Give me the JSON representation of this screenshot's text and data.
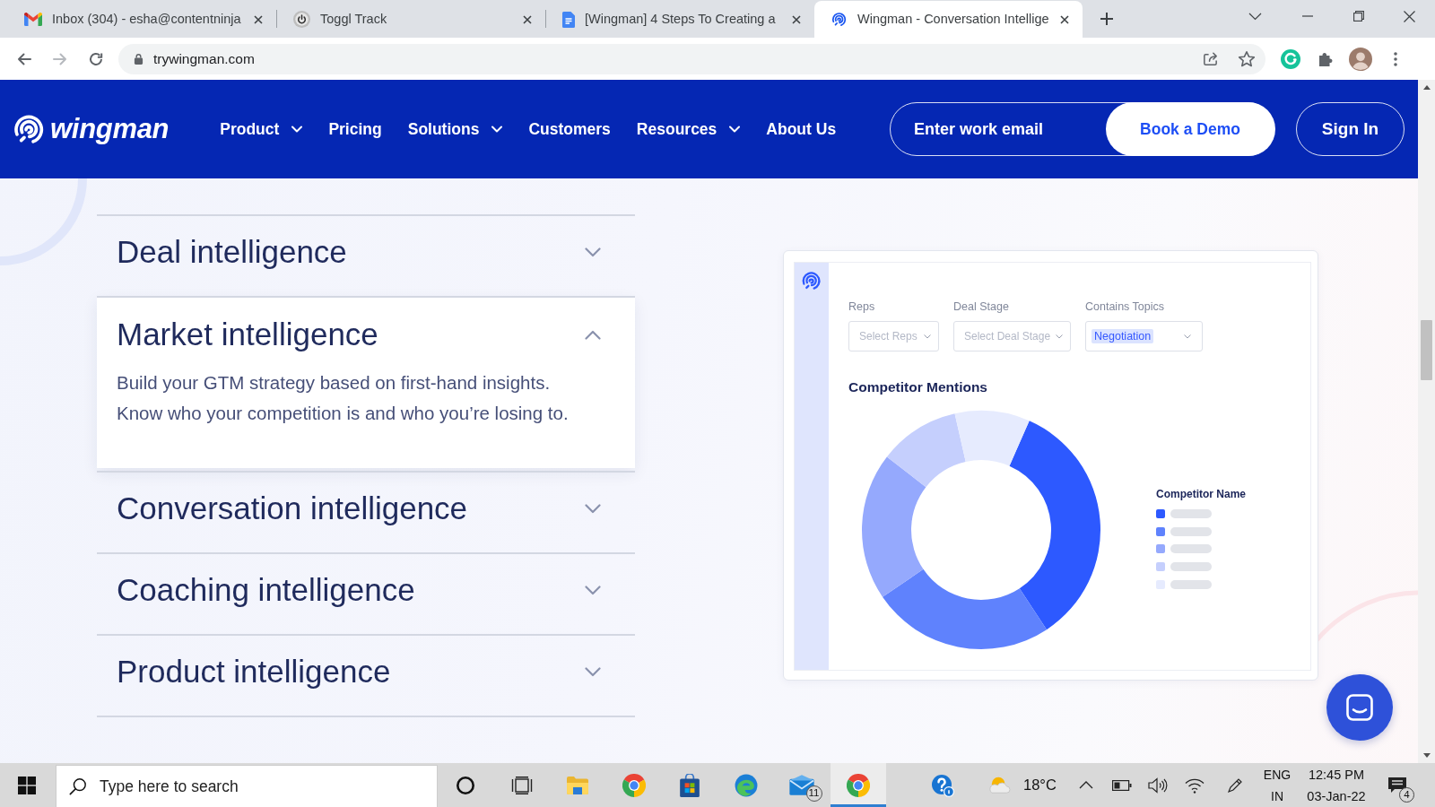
{
  "browser": {
    "tabs": [
      {
        "kind": "mail",
        "title": "Inbox (304) - esha@contentninja",
        "selected": false
      },
      {
        "kind": "timer",
        "title": "Toggl Track",
        "selected": false
      },
      {
        "kind": "document",
        "title": "[Wingman] 4 Steps To Creating a",
        "selected": false
      },
      {
        "kind": "site",
        "title": "Wingman - Conversation Intellige",
        "selected": true
      }
    ],
    "url": "trywingman.com"
  },
  "site_nav": {
    "logo": "wingman",
    "items": [
      {
        "label": "Product",
        "dropdown": true
      },
      {
        "label": "Pricing",
        "dropdown": false
      },
      {
        "label": "Solutions",
        "dropdown": true
      },
      {
        "label": "Customers",
        "dropdown": false
      },
      {
        "label": "Resources",
        "dropdown": true
      },
      {
        "label": "About Us",
        "dropdown": false
      }
    ],
    "email": {
      "placeholder": "Enter work email"
    },
    "demo_button": "Book a Demo",
    "sign_in": "Sign In"
  },
  "accordion": [
    {
      "title": "Deal intelligence",
      "expanded": false
    },
    {
      "title": "Market intelligence",
      "expanded": true,
      "body": [
        "Build your GTM strategy based on first-hand insights.",
        "Know who your competition is and who you’re losing to."
      ]
    },
    {
      "title": "Conversation intelligence",
      "expanded": false
    },
    {
      "title": "Coaching intelligence",
      "expanded": false
    },
    {
      "title": "Product intelligence",
      "expanded": false
    }
  ],
  "dashboard": {
    "filters": [
      {
        "label": "Reps",
        "placeholder": "Select Reps"
      },
      {
        "label": "Deal Stage",
        "placeholder": "Select Deal Stage"
      },
      {
        "label": "Contains Topics",
        "value": "Negotiation"
      }
    ],
    "chart_title": "Competitor Mentions",
    "legend": {
      "title": "Competitor Name",
      "items": [
        {
          "color": "#2d59ff"
        },
        {
          "color": "#5f82fd"
        },
        {
          "color": "#95a9fd"
        },
        {
          "color": "#c5cffd"
        },
        {
          "color": "#e6ebfe"
        }
      ]
    }
  },
  "taskbar": {
    "search": {
      "placeholder": "Type here to search"
    },
    "apps": [
      {
        "kind": "cortana",
        "selected": false
      },
      {
        "kind": "task_view",
        "selected": false
      },
      {
        "kind": "folder",
        "selected": false
      },
      {
        "kind": "chrome",
        "selected": false
      },
      {
        "kind": "store",
        "selected": false
      },
      {
        "kind": "edge",
        "selected": false
      },
      {
        "kind": "mail",
        "badge": "11",
        "selected": false
      },
      {
        "kind": "chrome",
        "selected": true
      }
    ],
    "weather": {
      "temperature": "18°C"
    },
    "language": [
      "ENG",
      "IN"
    ],
    "time": "12:45 PM",
    "date": "03-Jan-22",
    "notifications": "4"
  }
}
